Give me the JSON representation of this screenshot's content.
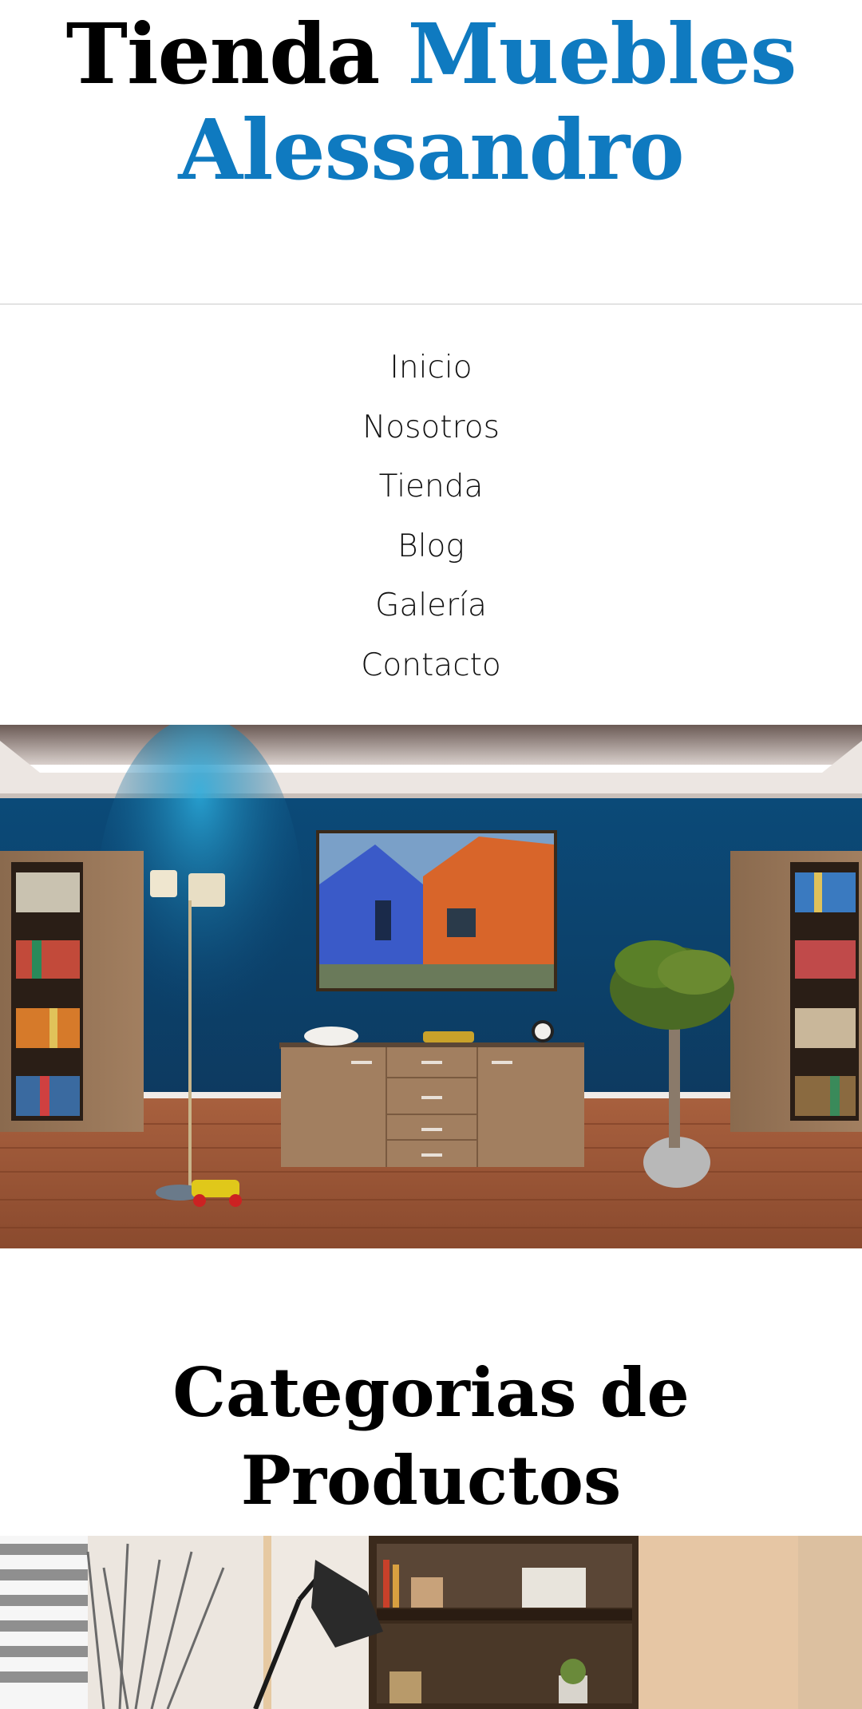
{
  "header": {
    "title_part1": "Tienda",
    "title_part2": "Muebles",
    "title_part3": "Alessandro",
    "accent_color": "#0f7ac0"
  },
  "nav": {
    "items": [
      {
        "label": "Inicio"
      },
      {
        "label": "Nosotros"
      },
      {
        "label": "Tienda"
      },
      {
        "label": "Blog"
      },
      {
        "label": "Galería"
      },
      {
        "label": "Contacto"
      }
    ]
  },
  "hero": {
    "image": "living-room-photo"
  },
  "categories": {
    "title": "Categorias de Productos",
    "image": "home-office-photo"
  }
}
